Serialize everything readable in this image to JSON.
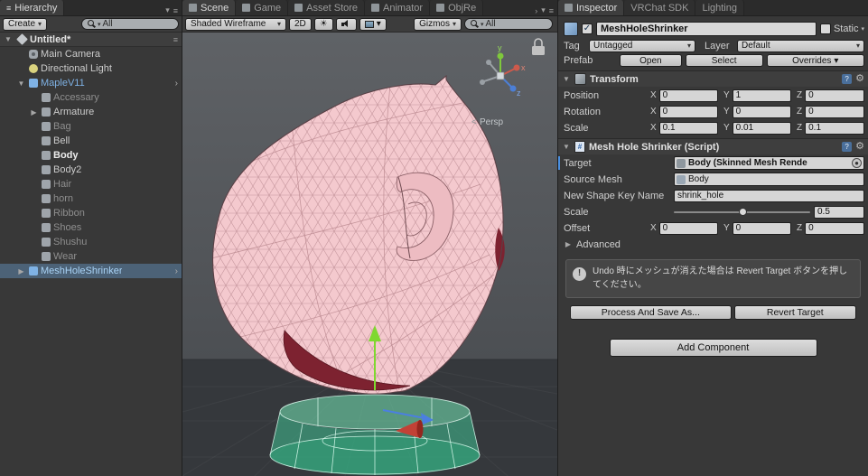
{
  "icons": {
    "menu": "≡",
    "dropdown": "▾",
    "fold_open": "▼",
    "fold_closed": "▶",
    "chevron_right": "›",
    "chevron_left": "<",
    "sun": "☀",
    "gear": "⚙",
    "check": "✓",
    "question": "?",
    "hash": "#",
    "info": "!",
    "dot": "●"
  },
  "hierarchy": {
    "tab_label": "Hierarchy",
    "create_label": "Create",
    "search_label": "All",
    "scene_name": "Untitled*",
    "items": [
      {
        "label": "Main Camera",
        "depth": 1,
        "icon": "camera-icon",
        "style": "normal"
      },
      {
        "label": "Directional Light",
        "depth": 1,
        "icon": "light-icon",
        "style": "normal"
      },
      {
        "label": "MapleV11",
        "depth": 1,
        "icon": "prefab-icon",
        "style": "prefab",
        "fold": "open",
        "right_arrow": true
      },
      {
        "label": "Accessary",
        "depth": 2,
        "icon": "gameobject-icon",
        "style": "dim"
      },
      {
        "label": "Armature",
        "depth": 2,
        "icon": "gameobject-icon",
        "style": "normal",
        "fold": "closed"
      },
      {
        "label": "Bag",
        "depth": 2,
        "icon": "gameobject-icon",
        "style": "dim"
      },
      {
        "label": "Bell",
        "depth": 2,
        "icon": "gameobject-icon",
        "style": "normal"
      },
      {
        "label": "Body",
        "depth": 2,
        "icon": "gameobject-icon",
        "style": "bold"
      },
      {
        "label": "Body2",
        "depth": 2,
        "icon": "gameobject-icon",
        "style": "normal"
      },
      {
        "label": "Hair",
        "depth": 2,
        "icon": "gameobject-icon",
        "style": "dim"
      },
      {
        "label": "horn",
        "depth": 2,
        "icon": "gameobject-icon",
        "style": "dim"
      },
      {
        "label": "Ribbon",
        "depth": 2,
        "icon": "gameobject-icon",
        "style": "dim"
      },
      {
        "label": "Shoes",
        "depth": 2,
        "icon": "gameobject-icon",
        "style": "dim"
      },
      {
        "label": "Shushu",
        "depth": 2,
        "icon": "gameobject-icon",
        "style": "dim"
      },
      {
        "label": "Wear",
        "depth": 2,
        "icon": "gameobject-icon",
        "style": "dim"
      },
      {
        "label": "MeshHoleShrinker",
        "depth": 1,
        "icon": "prefab-icon",
        "style": "prefab",
        "selected": true,
        "fold": "closed",
        "right_arrow": true
      }
    ]
  },
  "scene_view": {
    "tabs": [
      {
        "label": "Scene",
        "active": true,
        "icon": true
      },
      {
        "label": "Game",
        "icon": true
      },
      {
        "label": "Asset Store",
        "icon": true
      },
      {
        "label": "Animator",
        "icon": true
      },
      {
        "label": "ObjRe",
        "icon": true
      }
    ],
    "toolbar": {
      "draw_mode": "Shaded Wireframe",
      "toggle_2d": "2D",
      "gizmos_label": "Gizmos",
      "search_label": "All"
    },
    "overlay": {
      "persp_label": "Persp",
      "axis_x": "x",
      "axis_y": "y",
      "axis_z": "z"
    }
  },
  "inspector": {
    "tabs": [
      {
        "label": "Inspector",
        "active": true,
        "icon": true
      },
      {
        "label": "VRChat SDK"
      },
      {
        "label": "Lighting"
      }
    ],
    "header": {
      "name": "MeshHoleShrinker",
      "static_label": "Static"
    },
    "tag_layer": {
      "tag_label": "Tag",
      "tag_value": "Untagged",
      "layer_label": "Layer",
      "layer_value": "Default"
    },
    "prefab": {
      "label": "Prefab",
      "open": "Open",
      "select": "Select",
      "overrides": "Overrides"
    },
    "transform": {
      "title": "Transform",
      "axis_x": "X",
      "axis_y": "Y",
      "axis_z": "Z",
      "rows": [
        {
          "label": "Position",
          "x": "0",
          "y": "1",
          "z": "0"
        },
        {
          "label": "Rotation",
          "x": "0",
          "y": "0",
          "z": "0"
        },
        {
          "label": "Scale",
          "x": "0.1",
          "y": "0.01",
          "z": "0.1"
        }
      ]
    },
    "script": {
      "title": "Mesh Hole Shrinker (Script)",
      "target_label": "Target",
      "target_value": "Body (Skinned Mesh Rende",
      "source_label": "Source Mesh",
      "source_value": "Body",
      "shape_key_label": "New Shape Key Name",
      "shape_key_value": "shrink_hole",
      "scale_label": "Scale",
      "scale_value": "0.5",
      "scale_fraction": 0.5,
      "offset_label": "Offset",
      "offset": {
        "x": "0",
        "y": "0",
        "z": "0"
      },
      "advanced_label": "Advanced",
      "help_text": "Undo 時にメッシュが消えた場合は Revert Target ボタンを押してください。",
      "process_button": "Process And Save As...",
      "revert_button": "Revert Target"
    },
    "add_component_label": "Add Component"
  }
}
